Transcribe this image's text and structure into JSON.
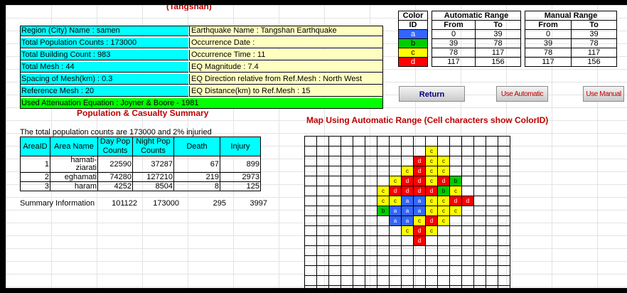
{
  "top_title": "(Tangshan)",
  "info": {
    "left": [
      "Region (City) Name : samen",
      "Total Population Counts : 173000",
      "Total Building Count : 983",
      "Total Mesh : 44",
      "Spacing of Mesh(km) : 0.3",
      "Reference Mesh : 20"
    ],
    "right": [
      "Earthquake Name : Tangshan Earthquake",
      "Occurrence Date :",
      "Occurrence Time : 11",
      "EQ Magnitude : 7.4",
      "EQ Direction relative from Ref.Mesh : North West",
      "EQ Distance(km) to Ref.Mesh : 15"
    ],
    "attenuation": "Used Attenuation Equation : Joyner & Boore - 1981"
  },
  "ranges": {
    "header_color": "Color",
    "header_id": "ID",
    "header_auto": "Automatic Range",
    "header_manual": "Manual Range",
    "header_from": "From",
    "header_to": "To",
    "rows": [
      {
        "id": "a",
        "color": "#3366ff",
        "auto_from": "0",
        "auto_to": "39",
        "man_from": "0",
        "man_to": "39"
      },
      {
        "id": "b",
        "color": "#00cc00",
        "auto_from": "39",
        "auto_to": "78",
        "man_from": "39",
        "man_to": "78"
      },
      {
        "id": "c",
        "color": "#ffff00",
        "auto_from": "78",
        "auto_to": "117",
        "man_from": "78",
        "man_to": "117"
      },
      {
        "id": "d",
        "color": "#ff0000",
        "auto_from": "117",
        "auto_to": "156",
        "man_from": "117",
        "man_to": "156"
      }
    ]
  },
  "buttons": {
    "return": "Return",
    "automatic": "Use Automatic",
    "manual": "Use Manual"
  },
  "population": {
    "title": "Population & Casualty Summary",
    "total_note": "The total population counts are 173000 and 2% injuried",
    "columns": [
      "AreaID",
      "Area Name",
      "Day Pop Counts",
      "Night Pop Counts",
      "Death",
      "Injury"
    ],
    "rows": [
      {
        "id": "1",
        "name": "hamati-ziarati",
        "day": "22590",
        "night": "37287",
        "death": "67",
        "injury": "899"
      },
      {
        "id": "2",
        "name": "eghamati",
        "day": "74280",
        "night": "127210",
        "death": "219",
        "injury": "2973"
      },
      {
        "id": "3",
        "name": "haram",
        "day": "4252",
        "night": "8504",
        "death": "8",
        "injury": "125"
      }
    ],
    "summary": {
      "label": "Summary Information",
      "day_pop": "101122",
      "night_pop": "173000",
      "death": "295",
      "injury": "3997"
    }
  },
  "map": {
    "title": "Map Using Automatic Range (Cell characters show ColorID)",
    "rows": [
      ".................",
      "..........c......",
      ".........dcc.....",
      "........cdcc.....",
      ".......cddcdb....",
      "......cddddbc....",
      "......ccaaccdd...",
      "......baaaccc....",
      ".......aacdc.....",
      "........cdc......",
      ".........d.......",
      ".................",
      ".................",
      ".................",
      ".................",
      "................."
    ]
  }
}
